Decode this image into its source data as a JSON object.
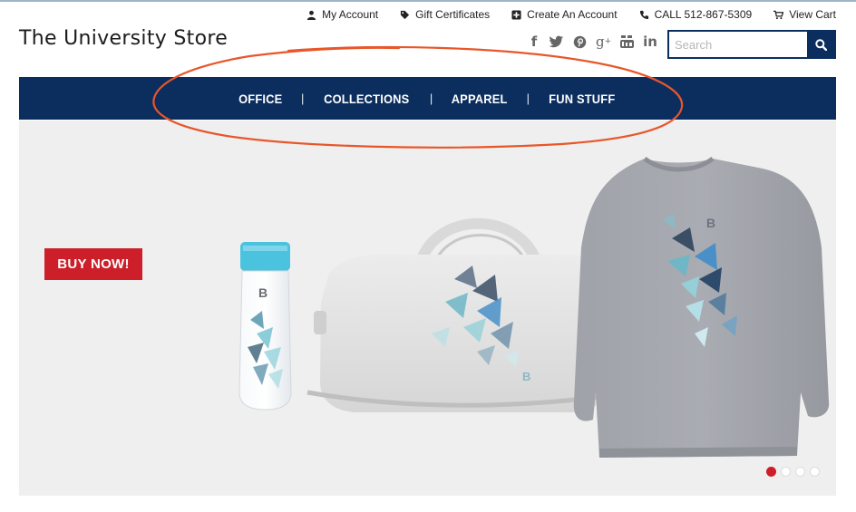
{
  "utility": {
    "my_account": "My Account",
    "gift_certificates": "Gift Certificates",
    "create_account": "Create An Account",
    "phone": "CALL 512-867-5309",
    "view_cart": "View Cart"
  },
  "store": {
    "title": "The University Store"
  },
  "social": [
    "facebook-icon",
    "twitter-icon",
    "pinterest-icon",
    "google-plus-icon",
    "youtube-icon",
    "linkedin-icon"
  ],
  "search": {
    "placeholder": "Search",
    "value": ""
  },
  "nav": {
    "items": [
      "OFFICE",
      "COLLECTIONS",
      "APPAREL",
      "FUN STUFF"
    ]
  },
  "hero": {
    "cta_label": "BUY NOW!",
    "slides_count": 4,
    "active_slide": 1
  },
  "colors": {
    "navy": "#0c2e5e",
    "red": "#cc1f2a",
    "annotation": "#e8562a",
    "hero_bg": "#efefef"
  }
}
